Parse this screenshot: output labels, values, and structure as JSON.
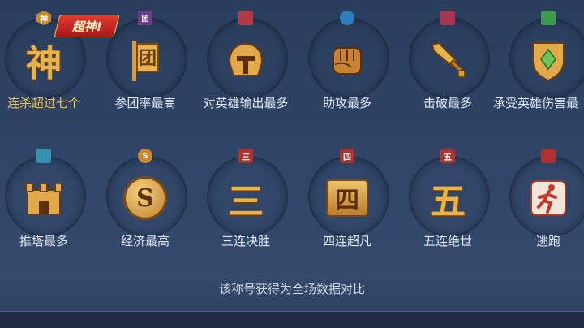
{
  "super_tag": "超神!",
  "badges_row1": [
    {
      "label": "连杀超过七个",
      "mini": "神",
      "mini_color": "#c98a2a",
      "highlight": true,
      "icon": "shen-character-icon"
    },
    {
      "label": "参团率最高",
      "mini": "团",
      "mini_color": "#6b3f8e",
      "highlight": false,
      "icon": "team-banner-icon"
    },
    {
      "label": "对英雄输出最多",
      "mini": "",
      "mini_color": "#b03a45",
      "highlight": false,
      "icon": "helmet-icon"
    },
    {
      "label": "助攻最多",
      "mini": "",
      "mini_color": "#2f7fc0",
      "highlight": false,
      "icon": "fist-icon"
    },
    {
      "label": "击破最多",
      "mini": "",
      "mini_color": "#a8334f",
      "highlight": false,
      "icon": "sword-icon"
    },
    {
      "label": "承受英雄伤害最",
      "mini": "",
      "mini_color": "#3c9b4e",
      "highlight": false,
      "icon": "shield-icon"
    }
  ],
  "badges_row2": [
    {
      "label": "推塔最多",
      "mini": "",
      "mini_color": "#3790b0",
      "icon": "tower-icon"
    },
    {
      "label": "经济最高",
      "mini": "S",
      "mini_color": "#c98a2a",
      "icon": "gold-coin-icon"
    },
    {
      "label": "三连决胜",
      "mini": "三",
      "mini_color": "#b0322e",
      "icon": "triple-kill-icon"
    },
    {
      "label": "四连超凡",
      "mini": "四",
      "mini_color": "#b0322e",
      "icon": "quadra-kill-icon"
    },
    {
      "label": "五连绝世",
      "mini": "五",
      "mini_color": "#b0322e",
      "icon": "penta-kill-icon"
    },
    {
      "label": "逃跑",
      "mini": "",
      "mini_color": "#b0322e",
      "icon": "running-man-icon"
    }
  ],
  "glyphs": {
    "shen": "神",
    "san": "三",
    "si": "四",
    "wu": "五",
    "coin": "S"
  },
  "footnote": "该称号获得为全场数据对比"
}
